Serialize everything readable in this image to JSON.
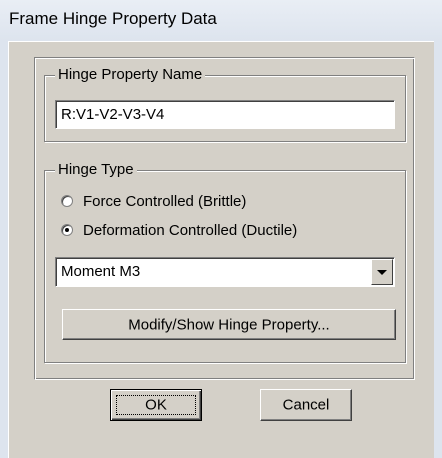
{
  "window": {
    "title": "Frame Hinge Property Data"
  },
  "hinge_property_name": {
    "legend": "Hinge Property Name",
    "value": "R:V1-V2-V3-V4"
  },
  "hinge_type": {
    "legend": "Hinge Type",
    "options": [
      {
        "label": "Force Controlled  (Brittle)",
        "selected": false
      },
      {
        "label": "Deformation Controlled  (Ductile)",
        "selected": true
      }
    ],
    "dropdown_value": "Moment M3",
    "modify_button": "Modify/Show Hinge Property..."
  },
  "buttons": {
    "ok": "OK",
    "cancel": "Cancel"
  }
}
